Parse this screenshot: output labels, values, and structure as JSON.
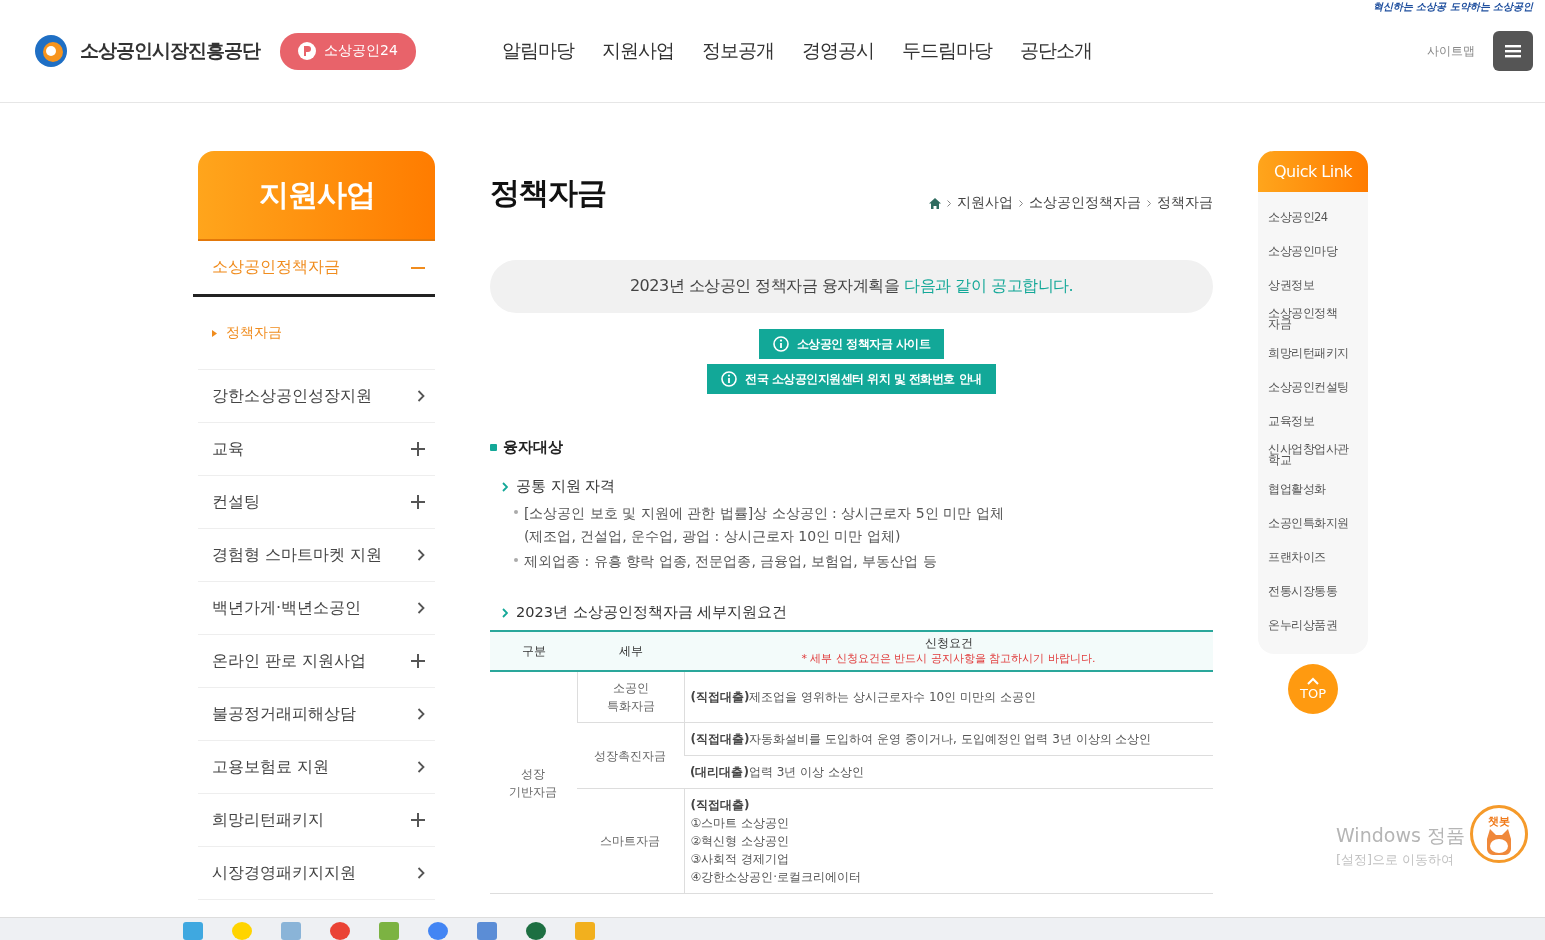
{
  "header": {
    "logo_text": "소상공인시장진흥공단",
    "portal_button": "소상공인24",
    "slogan": "혁신하는 소상공 도약하는 소상공인",
    "nav": [
      "알림마당",
      "지원사업",
      "정보공개",
      "경영공시",
      "두드림마당",
      "공단소개"
    ],
    "sitemap": "사이트맵"
  },
  "sidebar": {
    "title": "지원사업",
    "items": [
      {
        "label": "소상공인정책자금",
        "kind": "expandable",
        "expanded": true,
        "children": [
          {
            "label": "정책자금",
            "selected": true
          }
        ]
      },
      {
        "label": "강한소상공인성장지원",
        "kind": "link"
      },
      {
        "label": "교육",
        "kind": "expandable",
        "expanded": false
      },
      {
        "label": "컨설팅",
        "kind": "expandable",
        "expanded": false
      },
      {
        "label": "경험형 스마트마켓 지원",
        "kind": "link"
      },
      {
        "label": "백년가게·백년소공인",
        "kind": "link"
      },
      {
        "label": "온라인 판로 지원사업",
        "kind": "expandable",
        "expanded": false
      },
      {
        "label": "불공정거래피해상담",
        "kind": "link"
      },
      {
        "label": "고용보험료 지원",
        "kind": "link"
      },
      {
        "label": "희망리턴패키지",
        "kind": "expandable",
        "expanded": false
      },
      {
        "label": "시장경영패키지지원",
        "kind": "link"
      }
    ]
  },
  "content": {
    "title": "정책자금",
    "breadcrumb": [
      "지원사업",
      "소상공인정책자금",
      "정책자금"
    ],
    "notice": {
      "text": "2023년 소상공인 정책자금 융자계획을",
      "highlight": "다음과 같이 공고합니다."
    },
    "buttons": [
      "소상공인 정책자금 사이트",
      "전국 소상공인지원센터 위치 및 전화번호 안내"
    ],
    "section_title": "융자대상",
    "subsection_1": {
      "title": "공통 지원 자격",
      "bullets": [
        "[소상공인 보호 및 지원에 관한 법률]상 소상공인 : 상시근로자 5인 미만 업체\n(제조업, 건설업, 운수업, 광업 : 상시근로자 10인 미만 업체)",
        "제외업종 : 유흥 향락 업종, 전문업종, 금융업, 보험업, 부동산업 등"
      ]
    },
    "subsection_2": {
      "title": "2023년 소상공인정책자금 세부지원요건"
    },
    "table": {
      "columns": [
        "구분",
        "세부",
        "신청요건"
      ],
      "column_note": "* 세부 신청요건은 반드시 공지사항을 참고하시기 바랍니다.",
      "groups": [
        {
          "category": "성장\n기반자금",
          "rows": [
            {
              "name": "소공인\n특화자금",
              "requirements": [
                "**(직접대출)**제조업을 영위하는 상시근로자수 10인 미만의 소공인"
              ]
            },
            {
              "name": "성장촉진자금",
              "requirements": [
                "**(직접대출)**자동화설비를 도입하여 운영 중이거나, 도입예정인 업력 3년 이상의 소상인",
                "**(대리대출)**업력 3년 이상 소상인"
              ]
            },
            {
              "name": "스마트자금",
              "requirements": [
                "**(직접대출)**\n①스마트 소상공인\n②혁신형 소상공인\n③사회적 경제기업\n④강한소상공인·로컬크리에이터"
              ]
            }
          ]
        }
      ]
    }
  },
  "quick_link": {
    "title": "Quick Link",
    "items": [
      "소상공인24",
      "소상공인마당",
      "상권정보",
      "소상공인정책\n자금",
      "희망리턴패키지",
      "소상공인컨설팅",
      "교육정보",
      "신사업창업사관\n학교",
      "협업활성화",
      "소공인특화지원",
      "프랜차이즈",
      "전통시장통통",
      "온누리상품권"
    ],
    "top_button": "TOP"
  },
  "chatbot": {
    "label": "챗봇"
  },
  "os_notice": {
    "line_1": "Windows 정품",
    "line_2": "[설정]으로 이동하여"
  }
}
